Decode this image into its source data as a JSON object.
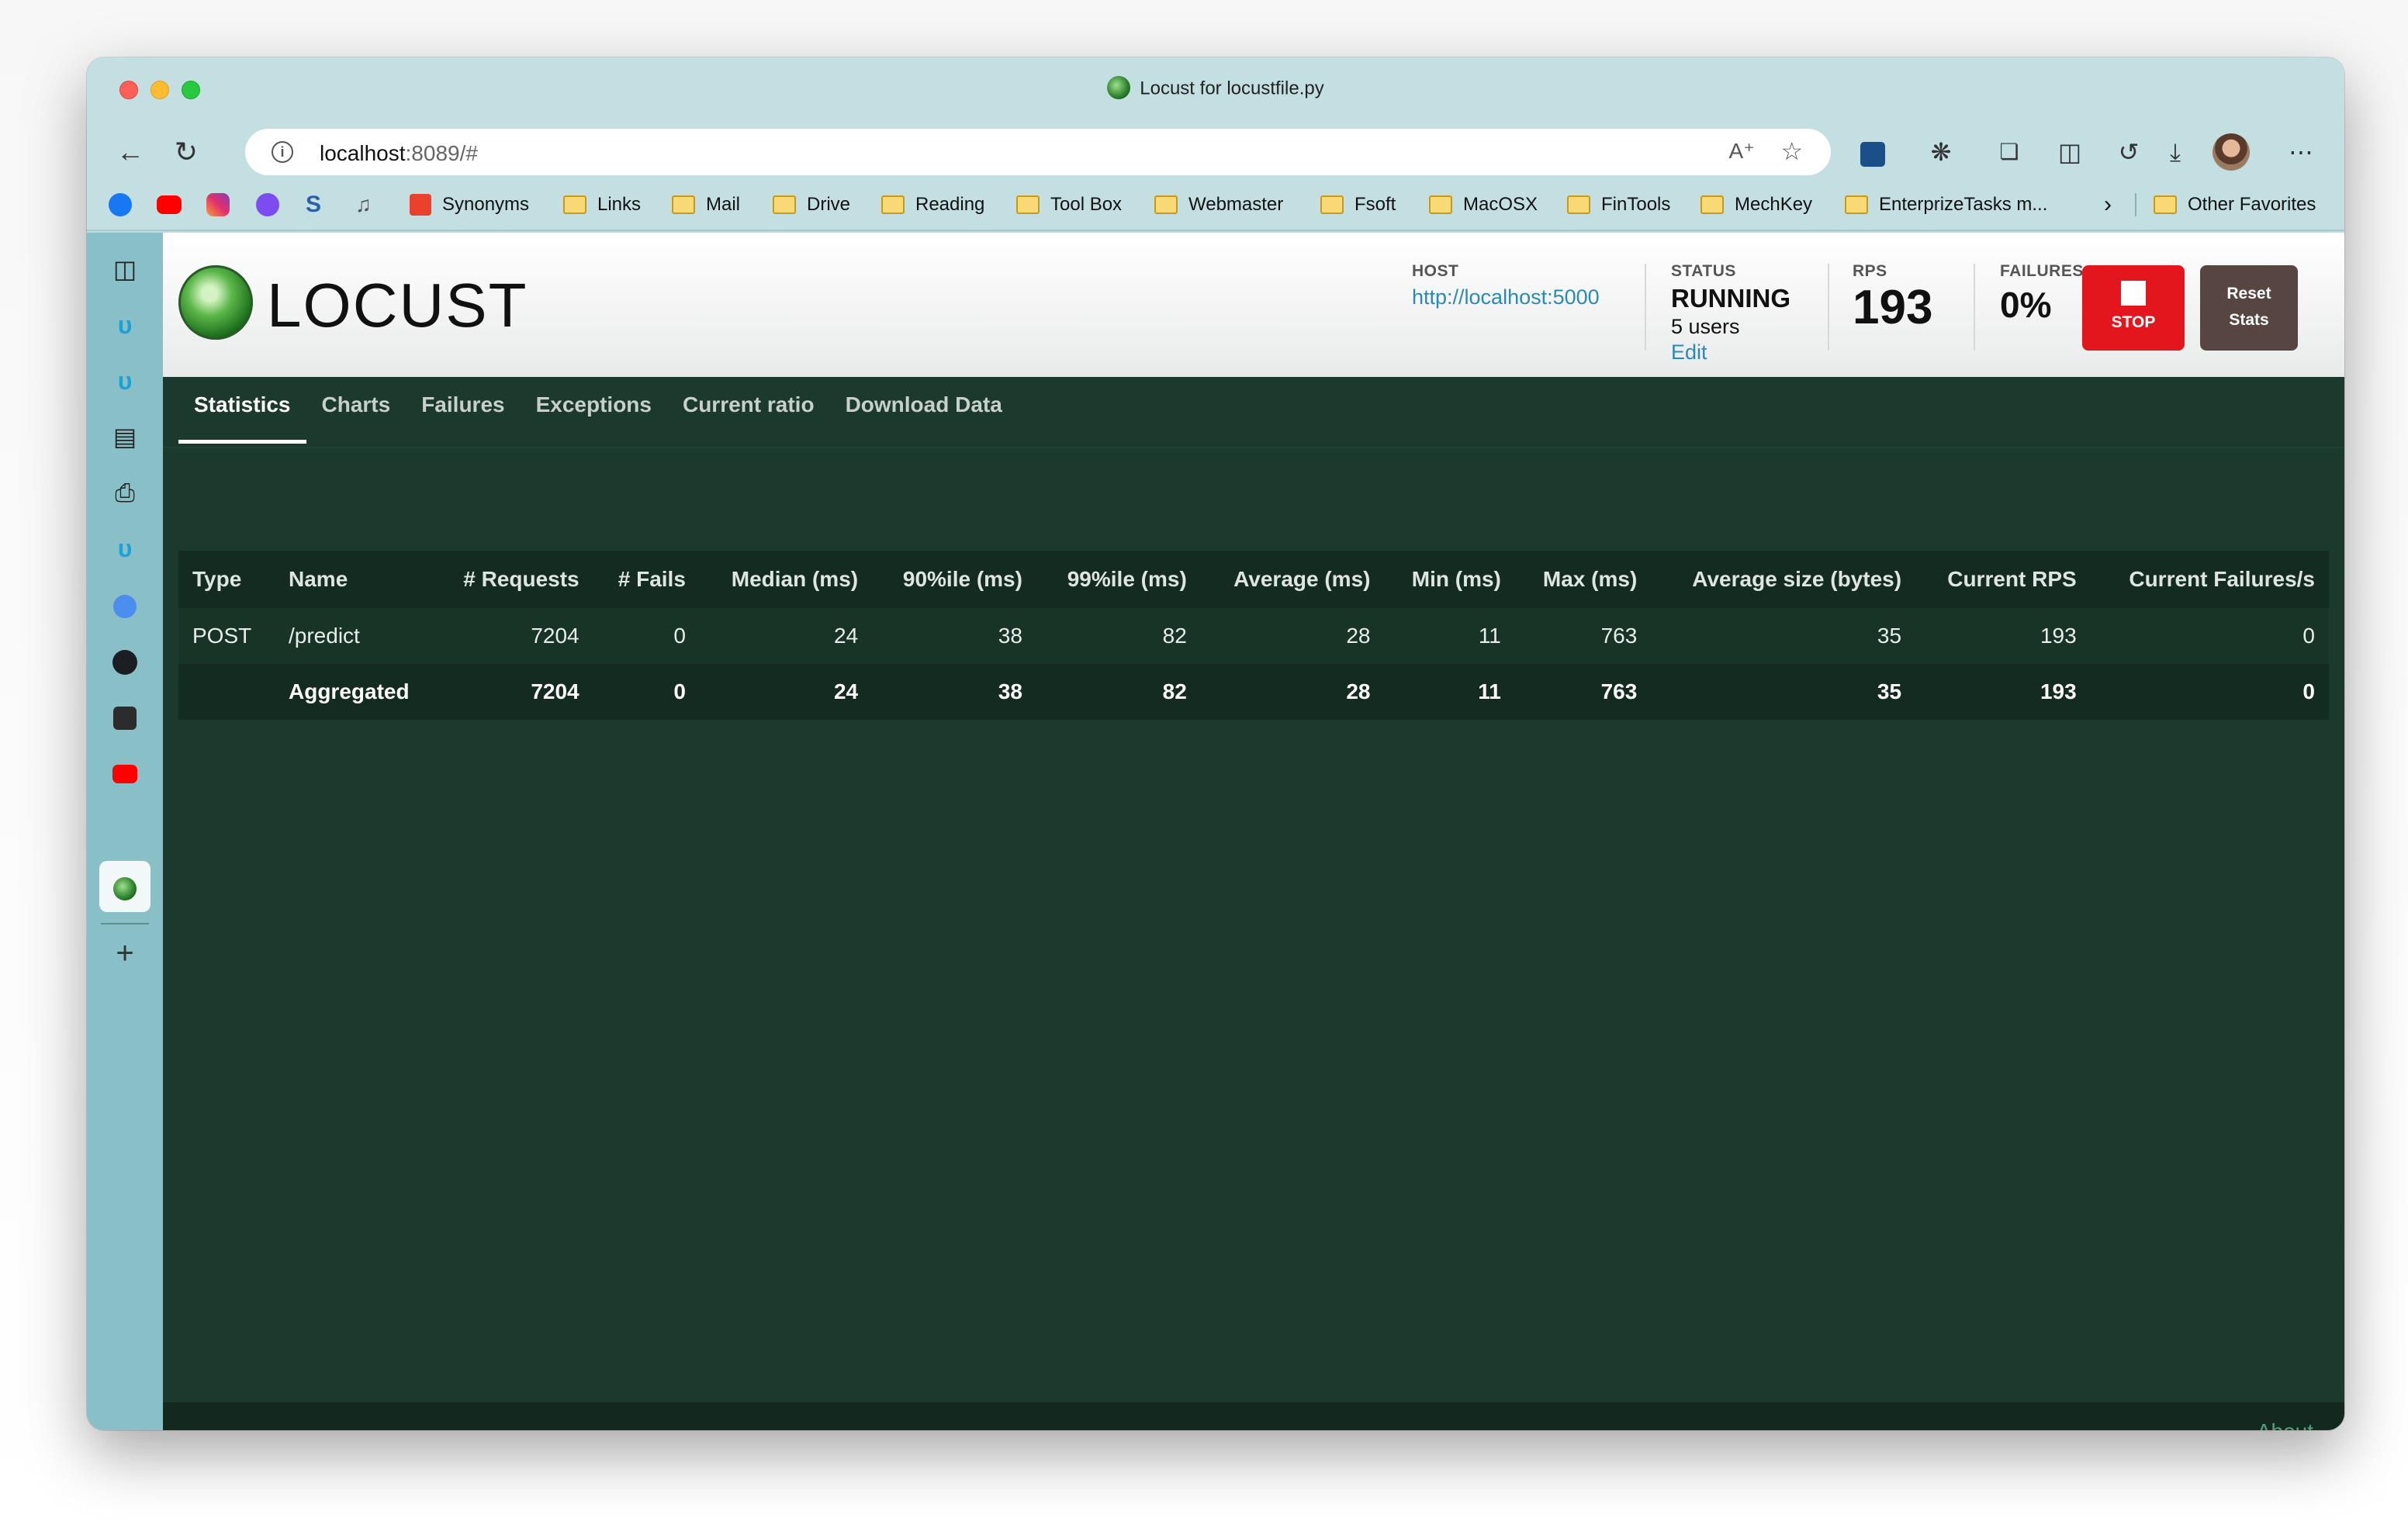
{
  "window": {
    "title": "Locust for locustfile.py"
  },
  "address": {
    "host": "localhost",
    "rest": ":8089/#"
  },
  "bookmarks": [
    {
      "label": "Synonyms"
    },
    {
      "label": "Links"
    },
    {
      "label": "Mail"
    },
    {
      "label": "Drive"
    },
    {
      "label": "Reading"
    },
    {
      "label": "Tool Box"
    },
    {
      "label": "Webmaster"
    },
    {
      "label": "Fsoft"
    },
    {
      "label": "MacOSX"
    },
    {
      "label": "FinTools"
    },
    {
      "label": "MechKey"
    },
    {
      "label": "EnterprizeTasks m..."
    },
    {
      "label": "Other Favorites"
    }
  ],
  "app": {
    "logo_text": "LOCUST",
    "host_label": "HOST",
    "host_value": "http://localhost:5000",
    "status_label": "STATUS",
    "status_value": "RUNNING",
    "users": "5 users",
    "edit": "Edit",
    "rps_label": "RPS",
    "rps_value": "193",
    "failures_label": "FAILURES",
    "failures_value": "0%",
    "stop_label": "STOP",
    "reset_line1": "Reset",
    "reset_line2": "Stats",
    "about": "About"
  },
  "tabs": [
    {
      "label": "Statistics",
      "active": true
    },
    {
      "label": "Charts"
    },
    {
      "label": "Failures"
    },
    {
      "label": "Exceptions"
    },
    {
      "label": "Current ratio"
    },
    {
      "label": "Download Data"
    }
  ],
  "table": {
    "headers": [
      "Type",
      "Name",
      "# Requests",
      "# Fails",
      "Median (ms)",
      "90%ile (ms)",
      "99%ile (ms)",
      "Average (ms)",
      "Min (ms)",
      "Max (ms)",
      "Average size (bytes)",
      "Current RPS",
      "Current Failures/s"
    ],
    "rows": [
      [
        "POST",
        "/predict",
        "7204",
        "0",
        "24",
        "38",
        "82",
        "28",
        "11",
        "763",
        "35",
        "193",
        "0"
      ],
      [
        "",
        "Aggregated",
        "7204",
        "0",
        "24",
        "38",
        "82",
        "28",
        "11",
        "763",
        "35",
        "193",
        "0"
      ]
    ]
  },
  "colors": {
    "app_bg": "#1b3a2d",
    "stop_button": "#e3161e",
    "reset_button": "#574542",
    "link": "#2a8ab5"
  }
}
